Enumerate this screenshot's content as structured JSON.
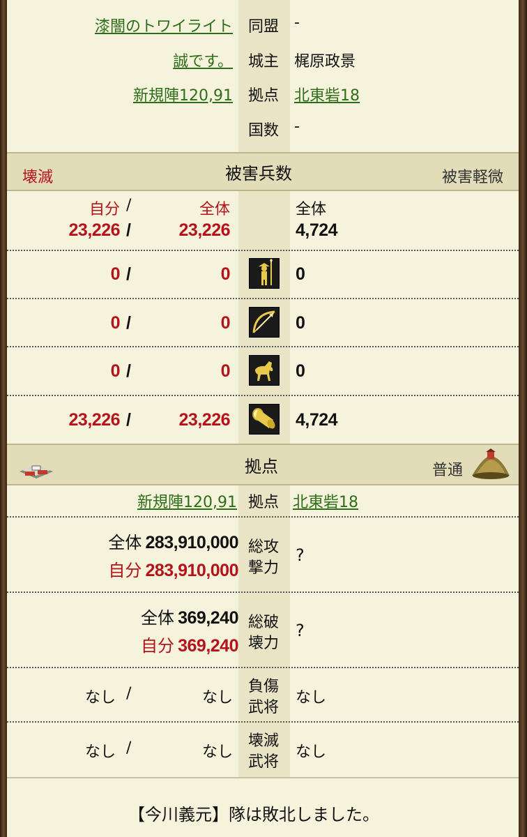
{
  "info": {
    "row1": {
      "left": "漆闇のトワイライト",
      "label": "同盟",
      "value": "-"
    },
    "row2": {
      "left": "誠です。",
      "label": "城主",
      "value": "梶原政景"
    },
    "row3": {
      "left": "新規陣120,91",
      "label": "拠点",
      "value": "北東砦18"
    },
    "row4": {
      "label": "国数",
      "value": "-"
    }
  },
  "damage": {
    "left_status": "壊滅",
    "title": "被害兵数",
    "right_status": "被害軽微",
    "head": {
      "self_label": "自分",
      "all_label": "全体",
      "sep": "/",
      "right_label": "全体",
      "self_value": "23,226",
      "all_value": "23,226",
      "right_value": "4,724"
    },
    "rows": [
      {
        "icon": "spearman-icon",
        "self": "0",
        "all": "0",
        "right": "0"
      },
      {
        "icon": "bow-icon",
        "self": "0",
        "all": "0",
        "right": "0"
      },
      {
        "icon": "horse-icon",
        "self": "0",
        "all": "0",
        "right": "0"
      },
      {
        "icon": "cannon-icon",
        "self": "23,226",
        "all": "23,226",
        "right": "4,724"
      }
    ]
  },
  "base": {
    "title": "拠点",
    "right_status": "普通",
    "left_link": "新規陣120,91",
    "label": "拠点",
    "right_link": "北東砦18",
    "attack": {
      "all_label": "全体",
      "all_value": "283,910,000",
      "self_label": "自分",
      "self_value": "283,910,000",
      "label1": "総攻",
      "label2": "撃力",
      "right": "?"
    },
    "destroy": {
      "all_label": "全体",
      "all_value": "369,240",
      "self_label": "自分",
      "self_value": "369,240",
      "label1": "総破",
      "label2": "壊力",
      "right": "?"
    },
    "injured": {
      "left1": "なし",
      "sep": "/",
      "left2": "なし",
      "label1": "負傷",
      "label2": "武将",
      "right": "なし"
    },
    "destroyed": {
      "left1": "なし",
      "sep": "/",
      "left2": "なし",
      "label1": "壊滅",
      "label2": "武将",
      "right": "なし"
    }
  },
  "footer": {
    "message": "【今川義元】隊は敗北しました。"
  },
  "colors": {
    "link": "#2e6e1a",
    "red": "#b5131b",
    "bg": "#f6f3dc",
    "header": "#e2dcb9"
  }
}
